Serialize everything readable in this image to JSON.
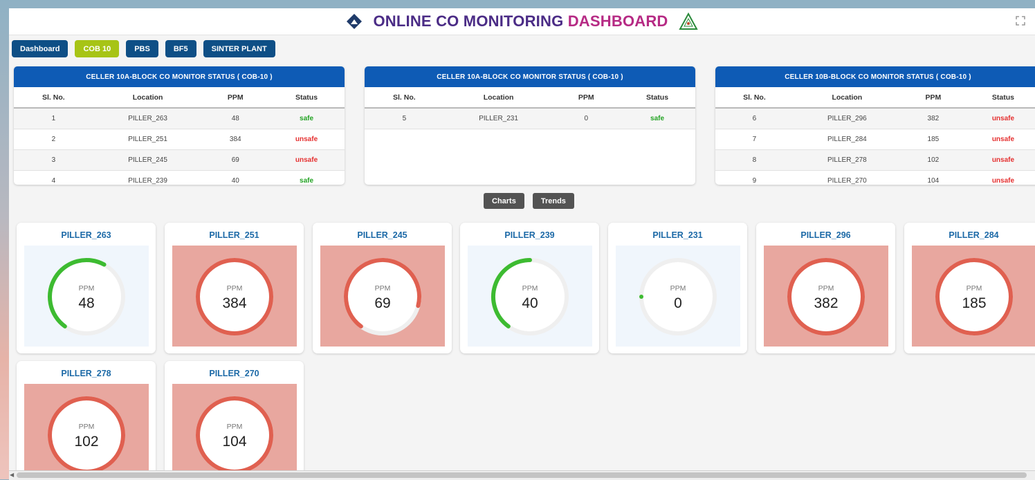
{
  "header": {
    "title_part1": "ONLINE CO MONITORING",
    "title_part2": "DASHBOARD"
  },
  "icons": {
    "left_logo": "sail-logo-icon",
    "right_logo": "emblem-logo-icon",
    "fullscreen": "expand-icon"
  },
  "nav": [
    {
      "label": "Dashboard",
      "active": false
    },
    {
      "label": "COB 10",
      "active": true
    },
    {
      "label": "PBS",
      "active": false
    },
    {
      "label": "BF5",
      "active": false
    },
    {
      "label": "SINTER PLANT",
      "active": false
    }
  ],
  "columns": {
    "sl": "Sl. No.",
    "location": "Location",
    "ppm": "PPM",
    "status": "Status"
  },
  "panels": [
    {
      "title": "CELLER 10A-BLOCK CO MONITOR STATUS ( COB-10 )",
      "rows": [
        {
          "sl": "1",
          "location": "PILLER_263",
          "ppm": "48",
          "status": "safe"
        },
        {
          "sl": "2",
          "location": "PILLER_251",
          "ppm": "384",
          "status": "unsafe"
        },
        {
          "sl": "3",
          "location": "PILLER_245",
          "ppm": "69",
          "status": "unsafe"
        },
        {
          "sl": "4",
          "location": "PILLER_239",
          "ppm": "40",
          "status": "safe"
        }
      ]
    },
    {
      "title": "CELLER 10A-BLOCK CO MONITOR STATUS ( COB-10 )",
      "rows": [
        {
          "sl": "5",
          "location": "PILLER_231",
          "ppm": "0",
          "status": "safe"
        }
      ]
    },
    {
      "title": "CELLER 10B-BLOCK CO MONITOR STATUS ( COB-10 )",
      "rows": [
        {
          "sl": "6",
          "location": "PILLER_296",
          "ppm": "382",
          "status": "unsafe"
        },
        {
          "sl": "7",
          "location": "PILLER_284",
          "ppm": "185",
          "status": "unsafe"
        },
        {
          "sl": "8",
          "location": "PILLER_278",
          "ppm": "102",
          "status": "unsafe"
        },
        {
          "sl": "9",
          "location": "PILLER_270",
          "ppm": "104",
          "status": "unsafe"
        }
      ]
    }
  ],
  "buttons": {
    "charts": "Charts",
    "trends": "Trends"
  },
  "gauge_unit": "PPM",
  "gauge_max": 100,
  "gauges": [
    {
      "name": "PILLER_263",
      "value": 48,
      "status": "safe"
    },
    {
      "name": "PILLER_251",
      "value": 384,
      "status": "unsafe"
    },
    {
      "name": "PILLER_245",
      "value": 69,
      "status": "unsafe"
    },
    {
      "name": "PILLER_239",
      "value": 40,
      "status": "safe"
    },
    {
      "name": "PILLER_231",
      "value": 0,
      "status": "safe"
    },
    {
      "name": "PILLER_296",
      "value": 382,
      "status": "unsafe"
    },
    {
      "name": "PILLER_284",
      "value": 185,
      "status": "unsafe"
    },
    {
      "name": "PILLER_278",
      "value": 102,
      "status": "unsafe"
    },
    {
      "name": "PILLER_270",
      "value": 104,
      "status": "unsafe"
    }
  ],
  "colors": {
    "safe": "#3dbb31",
    "unsafe": "#e06050",
    "safe_bg": "#f0f6fc",
    "unsafe_bg": "#e8a79f",
    "track": "#efefef"
  }
}
